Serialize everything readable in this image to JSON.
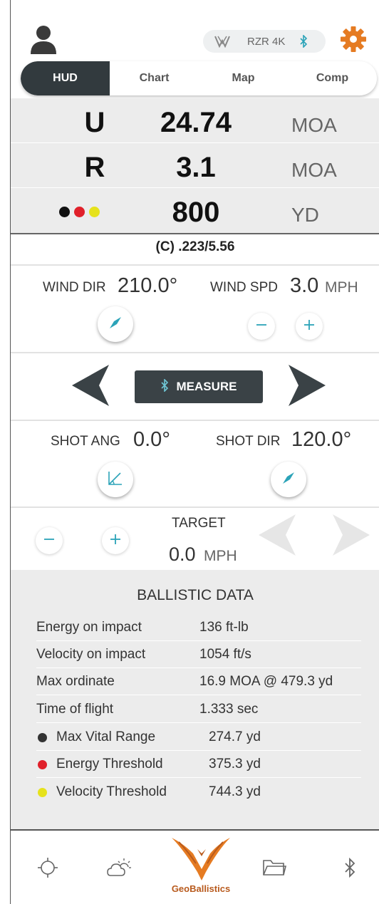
{
  "header": {
    "device_name": "RZR 4K",
    "icons": [
      "user-icon",
      "vortex-logo-icon",
      "bluetooth-icon",
      "gear-icon"
    ]
  },
  "tabs": [
    {
      "label": "HUD",
      "active": true
    },
    {
      "label": "Chart",
      "active": false
    },
    {
      "label": "Map",
      "active": false
    },
    {
      "label": "Comp",
      "active": false
    }
  ],
  "hud": {
    "elevation": {
      "label": "U",
      "value": "24.74",
      "unit": "MOA"
    },
    "windage": {
      "label": "R",
      "value": "3.1",
      "unit": "MOA"
    },
    "range": {
      "value": "800",
      "unit": "YD"
    },
    "dot_colors": [
      "#111111",
      "#e0202a",
      "#e6e21c"
    ]
  },
  "ammo": "(C) .223/5.56",
  "wind": {
    "dir_label": "WIND DIR",
    "dir_value": "210.0°",
    "spd_label": "WIND SPD",
    "spd_value": "3.0",
    "spd_unit": "MPH"
  },
  "measure": {
    "label": "MEASURE"
  },
  "shot": {
    "ang_label": "SHOT ANG",
    "ang_value": "0.0°",
    "dir_label": "SHOT DIR",
    "dir_value": "120.0°"
  },
  "target": {
    "label": "TARGET",
    "value": "0.0",
    "unit": "MPH"
  },
  "ballistic": {
    "title": "BALLISTIC DATA",
    "rows": [
      {
        "label": "Energy on impact",
        "value": "136 ft-lb"
      },
      {
        "label": "Velocity on impact",
        "value": "1054 ft/s"
      },
      {
        "label": "Max ordinate",
        "value": "16.9 MOA @ 479.3 yd"
      },
      {
        "label": "Time of flight",
        "value": "1.333 sec"
      },
      {
        "label": "Max Vital Range",
        "value": "274.7 yd",
        "dot": "#333333"
      },
      {
        "label": "Energy Threshold",
        "value": "375.3 yd",
        "dot": "#e0202a"
      },
      {
        "label": "Velocity Threshold",
        "value": "744.3 yd",
        "dot": "#e6e21c"
      }
    ]
  },
  "nav": {
    "items": [
      "crosshair-icon",
      "weather-icon",
      "geoballistics-logo-icon",
      "folder-icon",
      "bluetooth-icon"
    ],
    "brand": "GeoBallistics"
  },
  "colors": {
    "accent": "#2ba3b8",
    "orange": "#e57b22",
    "dark": "#323a3e"
  }
}
